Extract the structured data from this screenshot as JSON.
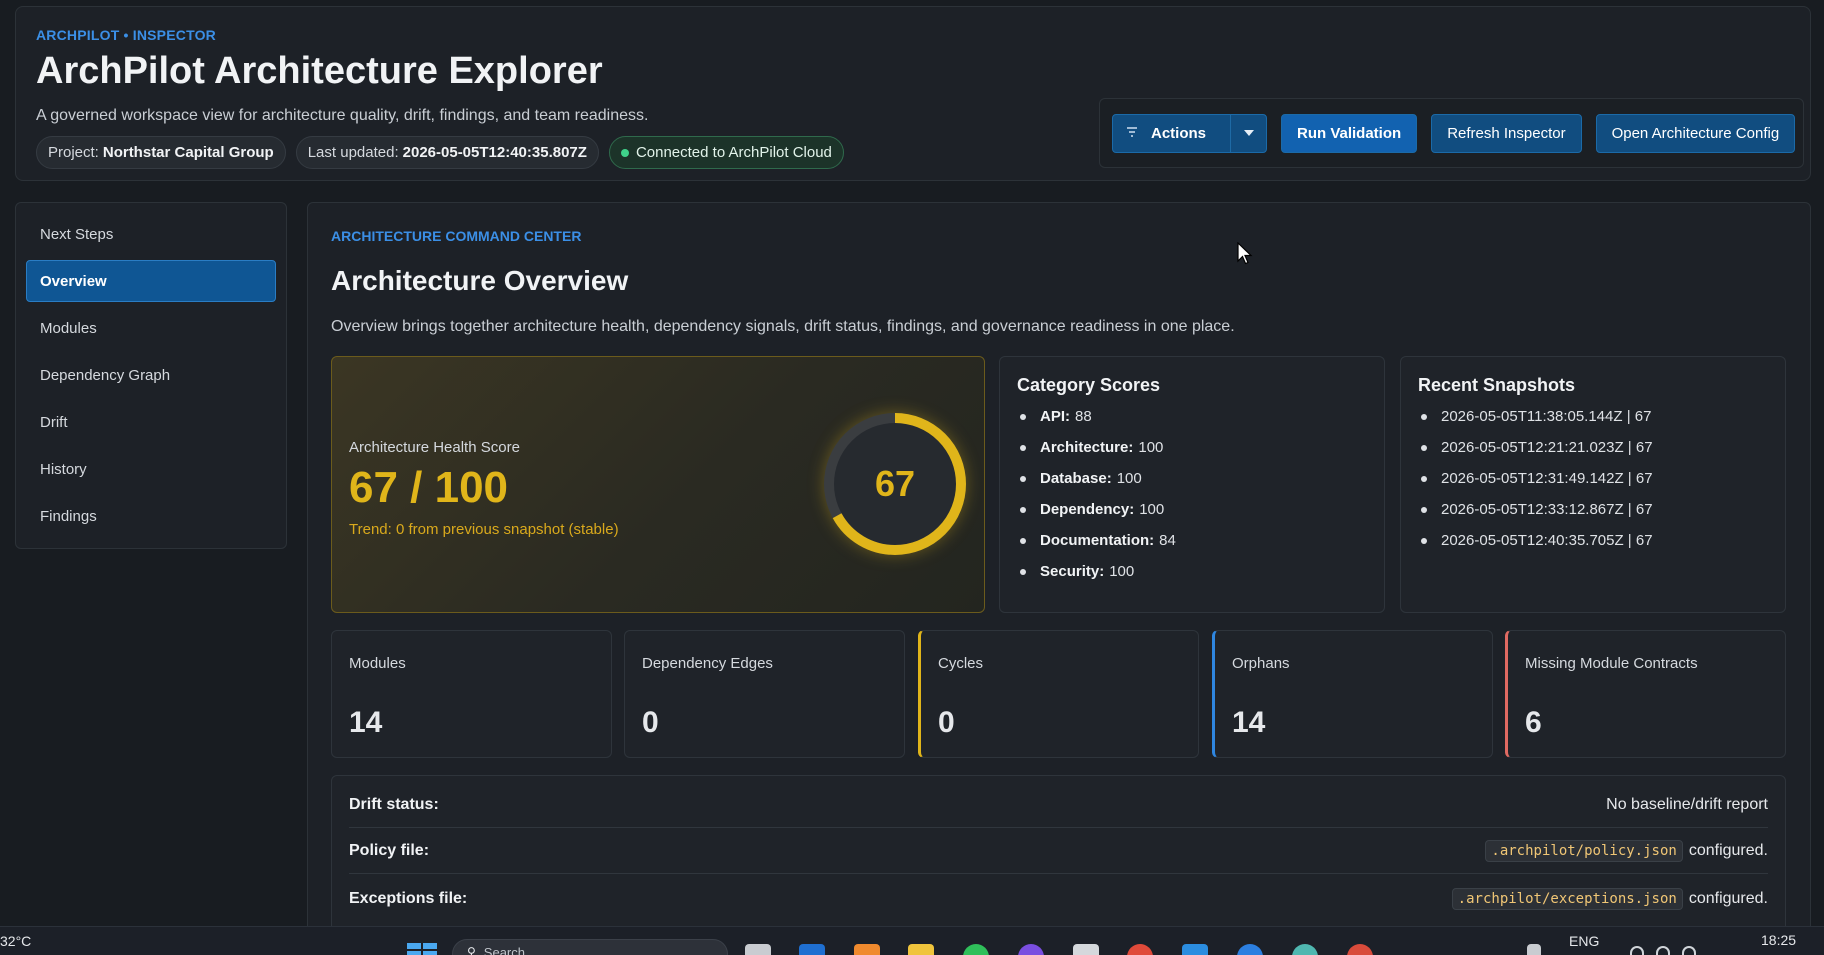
{
  "header": {
    "eyebrow": "ARCHPILOT • INSPECTOR",
    "title": "ArchPilot Architecture Explorer",
    "subtitle": "A governed workspace view for architecture quality, drift, findings, and team readiness.",
    "project_label": "Project:",
    "project_value": "Northstar Capital Group",
    "updated_label": "Last updated:",
    "updated_value": "2026-05-05T12:40:35.807Z",
    "connection": "Connected to ArchPilot Cloud",
    "buttons": {
      "actions": "Actions",
      "run_validation": "Run Validation",
      "refresh": "Refresh Inspector",
      "open_config": "Open Architecture Config"
    }
  },
  "sidebar": {
    "items": [
      {
        "label": "Next Steps",
        "active": false
      },
      {
        "label": "Overview",
        "active": true
      },
      {
        "label": "Modules",
        "active": false
      },
      {
        "label": "Dependency Graph",
        "active": false
      },
      {
        "label": "Drift",
        "active": false
      },
      {
        "label": "History",
        "active": false
      },
      {
        "label": "Findings",
        "active": false
      }
    ]
  },
  "main": {
    "eyebrow": "ARCHITECTURE COMMAND CENTER",
    "title": "Architecture Overview",
    "description": "Overview brings together architecture health, dependency signals, drift status, findings, and governance readiness in one place.",
    "health": {
      "label": "Architecture Health Score",
      "score_text": "67 / 100",
      "score": 67,
      "max": 100,
      "ring_value": "67",
      "trend": "Trend: 0 from previous snapshot (stable)"
    },
    "category_scores": {
      "title": "Category Scores",
      "items": [
        {
          "name": "API:",
          "value": "88"
        },
        {
          "name": "Architecture:",
          "value": "100"
        },
        {
          "name": "Database:",
          "value": "100"
        },
        {
          "name": "Dependency:",
          "value": "100"
        },
        {
          "name": "Documentation:",
          "value": "84"
        },
        {
          "name": "Security:",
          "value": "100"
        }
      ]
    },
    "recent_snapshots": {
      "title": "Recent Snapshots",
      "items": [
        "2026-05-05T11:38:05.144Z | 67",
        "2026-05-05T12:21:21.023Z | 67",
        "2026-05-05T12:31:49.142Z | 67",
        "2026-05-05T12:33:12.867Z | 67",
        "2026-05-05T12:40:35.705Z | 67"
      ]
    },
    "stats": [
      {
        "label": "Modules",
        "value": "14"
      },
      {
        "label": "Dependency Edges",
        "value": "0"
      },
      {
        "label": "Cycles",
        "value": "0"
      },
      {
        "label": "Orphans",
        "value": "14"
      },
      {
        "label": "Missing Module Contracts",
        "value": "6"
      }
    ],
    "details": [
      {
        "key": "Drift status:",
        "code": "",
        "value": "No baseline/drift report"
      },
      {
        "key": "Policy file:",
        "code": ".archpilot/policy.json",
        "value": "configured."
      },
      {
        "key": "Exceptions file:",
        "code": ".archpilot/exceptions.json",
        "value": "configured."
      }
    ]
  },
  "taskbar": {
    "weather": "32°C",
    "search_placeholder": "Search",
    "language": "ENG",
    "time": "18:25"
  },
  "colors": {
    "accent": "#3b8fe6",
    "primary_button": "#1262b0",
    "health": "#e0b51a",
    "connected": "#3fd28a",
    "orphans": "#2f86e0",
    "missing_contracts": "#e06a62"
  }
}
